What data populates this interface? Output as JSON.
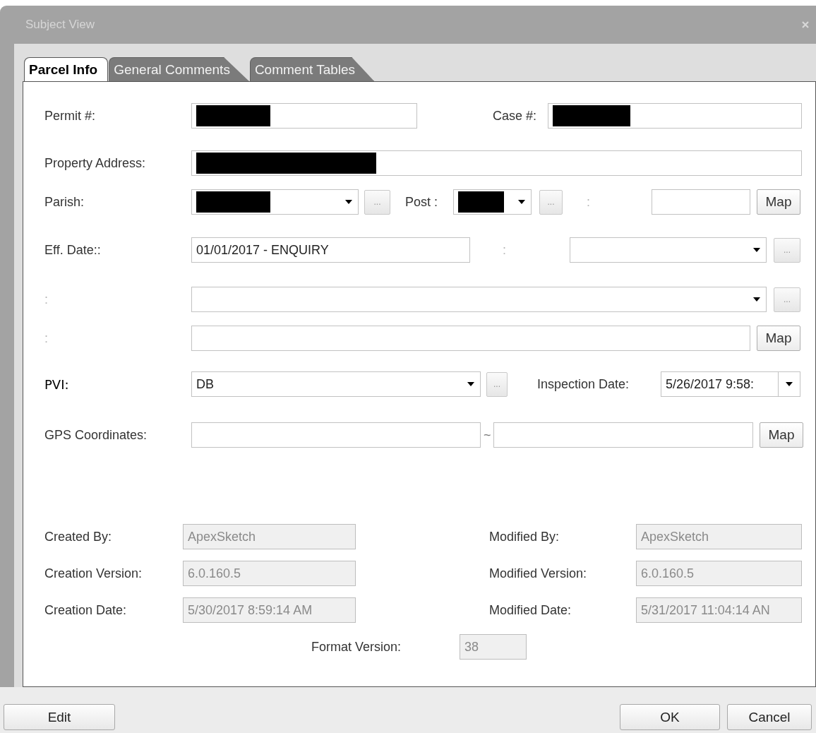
{
  "window": {
    "title": "Subject View"
  },
  "tabs": [
    {
      "label": "Parcel Info",
      "selected": true
    },
    {
      "label": "General Comments",
      "selected": false
    },
    {
      "label": "Comment Tables",
      "selected": false
    }
  ],
  "form": {
    "permit": {
      "label": "Permit #:",
      "redacted": true
    },
    "case": {
      "label": "Case #:",
      "redacted": true
    },
    "property_address": {
      "label": "Property Address:",
      "redacted": true
    },
    "parish": {
      "label": "Parish:",
      "redacted": true,
      "browse": "..."
    },
    "post": {
      "label": "Post :",
      "redacted": true,
      "browse": "..."
    },
    "field_1": {
      "label": ":",
      "map": "Map"
    },
    "eff_date": {
      "label": "Eff. Date::",
      "value": "01/01/2017 - ENQUIRY"
    },
    "field_2": {
      "label": ":",
      "browse": "..."
    },
    "field_3": {
      "label": ":",
      "browse": "..."
    },
    "field_4": {
      "label": ":",
      "map": "Map"
    },
    "pvi": {
      "label": "PVI:",
      "value": "DB",
      "browse": "..."
    },
    "inspection_date": {
      "label": "Inspection Date:",
      "value": "5/26/2017 9:58:"
    },
    "gps": {
      "label": "GPS Coordinates:",
      "separator": "~",
      "map": "Map"
    }
  },
  "audit_rows": [
    {
      "left": {
        "label": "Created By:",
        "value": "ApexSketch",
        "disabled": true
      },
      "right": {
        "label": "Modified By:",
        "value": "ApexSketch",
        "disabled": true
      }
    },
    {
      "left": {
        "label": "Creation Version:",
        "value": "6.0.160.5",
        "disabled": true
      },
      "right": {
        "label": "Modified Version:",
        "value": "6.0.160.5",
        "disabled": true
      }
    },
    {
      "left": {
        "label": "Creation Date:",
        "value": "5/30/2017 8:59:14 AM",
        "disabled": true
      },
      "right": {
        "label": "Modified Date:",
        "value": "5/31/2017 11:04:14 AN",
        "disabled": true
      }
    }
  ],
  "format_version": {
    "label": "Format Version:",
    "value": "38",
    "disabled": true
  },
  "buttons": {
    "edit": "Edit",
    "ok": "OK",
    "cancel": "Cancel"
  }
}
